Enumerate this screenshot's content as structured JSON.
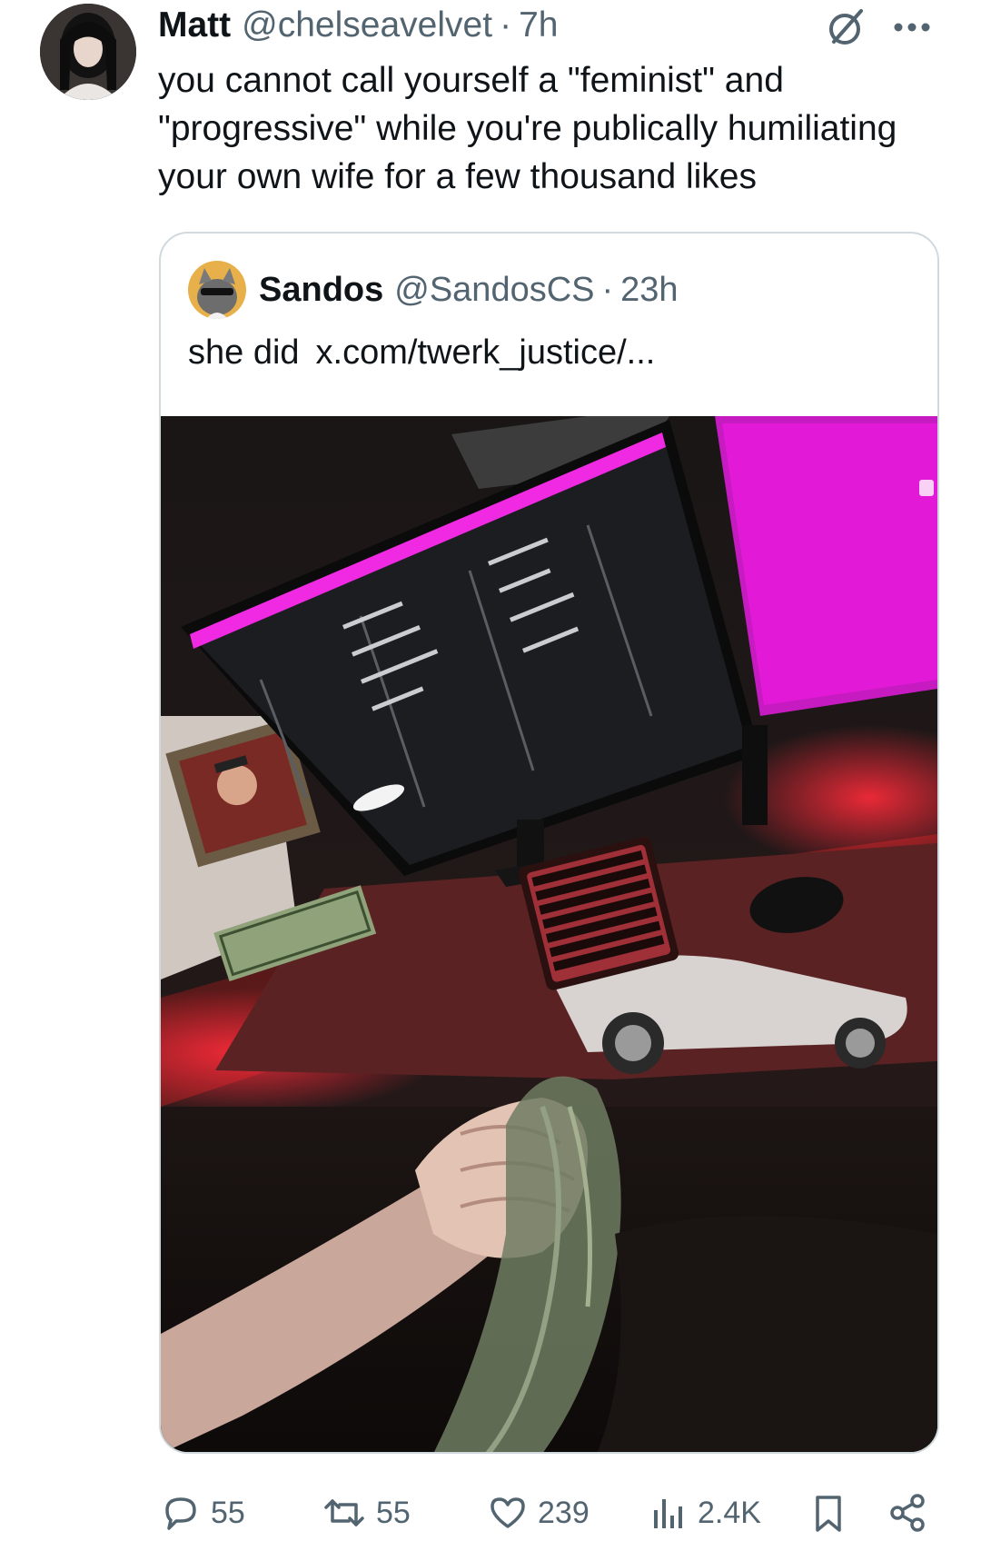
{
  "tweet": {
    "author_name": "Matt",
    "author_handle": "@chelseavelvet",
    "separator": "·",
    "time": "7h",
    "text": "you cannot call yourself a \"feminist\" and \"progressive\" while you're publically humiliating your own wife for a few thousand likes"
  },
  "quoted": {
    "author_name": "Sandos",
    "author_handle": "@SandosCS",
    "separator": "·",
    "time": "23h",
    "text": "she did",
    "link": "x.com/twerk_justice/..."
  },
  "actions": {
    "replies": "55",
    "reposts": "55",
    "likes": "239",
    "views": "2.4K"
  },
  "icons": {
    "grok": "grok-icon",
    "more": "more-icon",
    "reply": "reply-icon",
    "repost": "repost-icon",
    "like": "heart-icon",
    "views": "views-icon",
    "bookmark": "bookmark-icon",
    "share": "share-icon"
  },
  "colors": {
    "text": "#0f1419",
    "muted": "#536471",
    "border": "#cfd9de",
    "screen_accent": "#e01bd9"
  }
}
